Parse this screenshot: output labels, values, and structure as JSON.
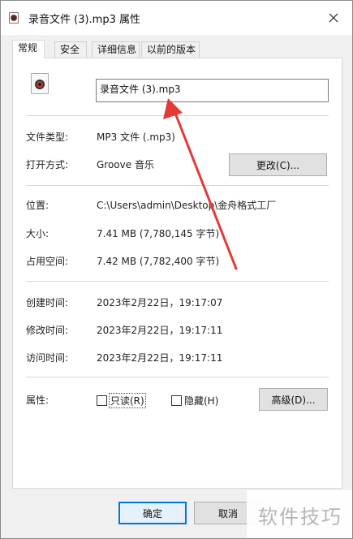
{
  "window": {
    "title": "录音文件 (3).mp3 属性",
    "close_glyph": "✕"
  },
  "tabs": [
    {
      "label": "常规",
      "active": true
    },
    {
      "label": "安全",
      "active": false
    },
    {
      "label": "详细信息",
      "active": false
    },
    {
      "label": "以前的版本",
      "active": false
    }
  ],
  "general": {
    "file_name": "录音文件 (3).mp3",
    "file_type_label": "文件类型:",
    "file_type_value": "MP3 文件 (.mp3)",
    "open_with_label": "打开方式:",
    "open_with_value": "Groove 音乐",
    "change_button": "更改(C)...",
    "location_label": "位置:",
    "location_value": "C:\\Users\\admin\\Desktop\\金舟格式工厂",
    "size_label": "大小:",
    "size_value": "7.41 MB (7,780,145 字节)",
    "size_on_disk_label": "占用空间:",
    "size_on_disk_value": "7.42 MB (7,782,400 字节)",
    "created_label": "创建时间:",
    "created_value": "2023年2月22日，19:17:07",
    "modified_label": "修改时间:",
    "modified_value": "2023年2月22日，19:17:11",
    "accessed_label": "访问时间:",
    "accessed_value": "2023年2月22日，19:17:11",
    "attributes_label": "属性:",
    "readonly_label": "只读(R)",
    "readonly_checked": false,
    "hidden_label": "隐藏(H)",
    "hidden_checked": false,
    "advanced_button": "高级(D)..."
  },
  "footer": {
    "ok_button": "确定",
    "cancel_button": "取消"
  },
  "watermark_text": "软件技巧",
  "colors": {
    "annotation_arrow": "#e53935",
    "ok_border": "#0078d7"
  }
}
